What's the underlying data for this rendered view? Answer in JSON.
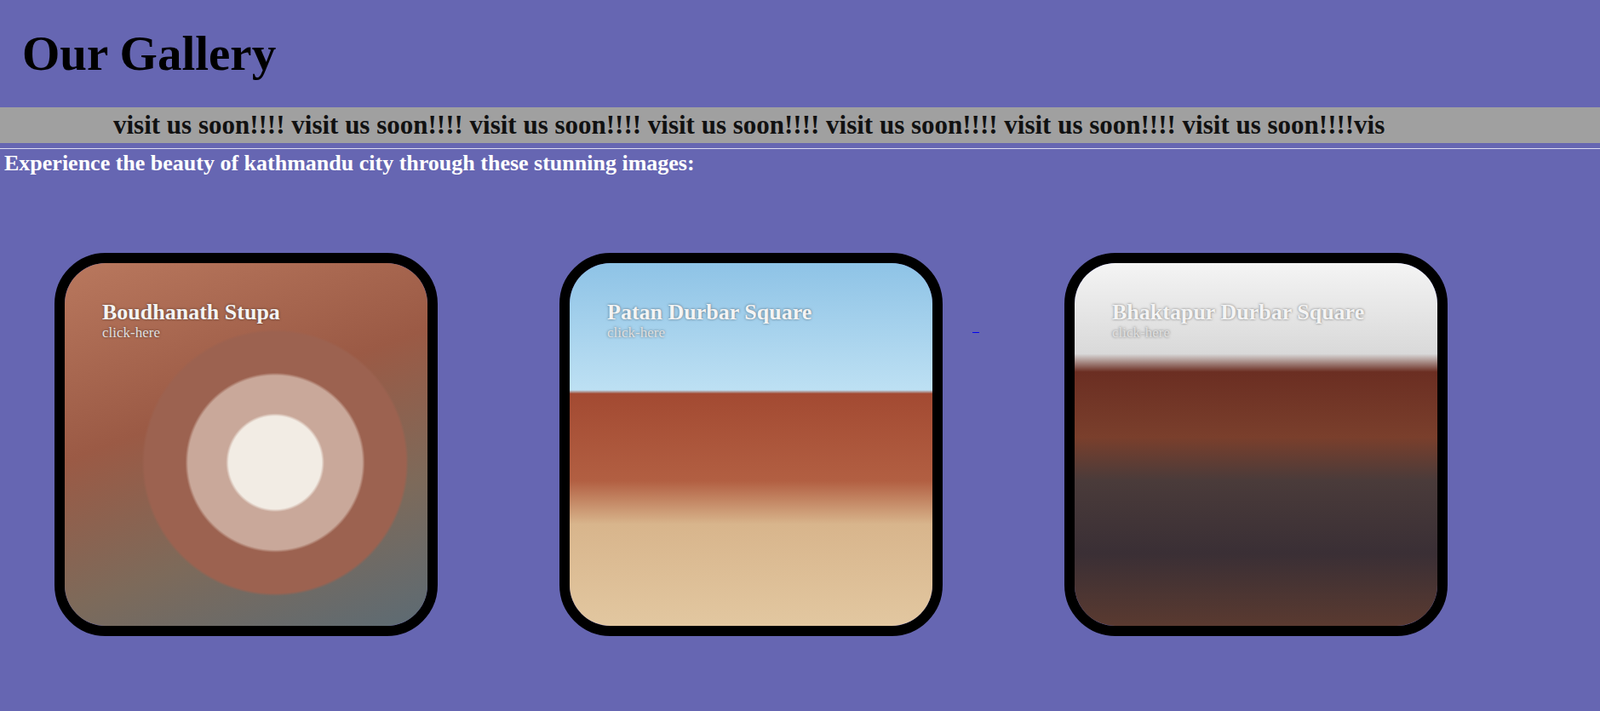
{
  "header": {
    "title": "Our Gallery"
  },
  "marquee": {
    "text": "visit us soon!!!! visit us soon!!!! visit us soon!!!! visit us soon!!!! visit us soon!!!! visit us soon!!!! visit us soon!!!!vis"
  },
  "subtitle": "Experience the beauty of kathmandu city through these stunning images:",
  "cards": [
    {
      "title": "Boudhanath Stupa",
      "link": "click-here"
    },
    {
      "title": "Patan Durbar Square",
      "link": "click-here"
    },
    {
      "title": "Bhaktapur Durbar Square",
      "link": "click-here"
    }
  ]
}
